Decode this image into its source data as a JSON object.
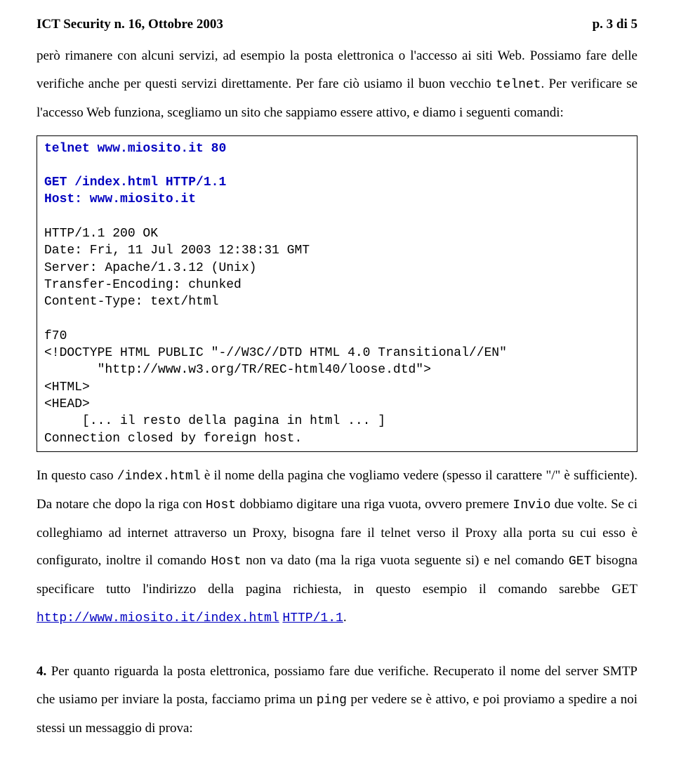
{
  "header": {
    "left": "ICT Security n. 16, Ottobre 2003",
    "right": "p. 3 di 5"
  },
  "p1": {
    "t1": "però rimanere con alcuni servizi, ad esempio la posta elettronica o l'accesso ai siti Web. Possiamo fare delle verifiche anche per questi servizi direttamente. Per fare ciò usiamo il buon vecchio ",
    "mono1": "telnet",
    "t2": ". Per verificare se l'accesso Web funziona, scegliamo un sito che sappiamo essere attivo, e diamo i seguenti comandi:"
  },
  "code": {
    "l1": "telnet www.miosito.it 80",
    "l2": "",
    "l3": "GET /index.html HTTP/1.1",
    "l4": "Host: www.miosito.it",
    "l5": "",
    "l6": "HTTP/1.1 200 OK",
    "l7": "Date: Fri, 11 Jul 2003 12:38:31 GMT",
    "l8": "Server: Apache/1.3.12 (Unix)",
    "l9": "Transfer-Encoding: chunked",
    "l10": "Content-Type: text/html",
    "l11": "",
    "l12": "f70",
    "l13": "<!DOCTYPE HTML PUBLIC \"-//W3C//DTD HTML 4.0 Transitional//EN\"",
    "l14": "       \"http://www.w3.org/TR/REC-html40/loose.dtd\">",
    "l15": "<HTML>",
    "l16": "<HEAD>",
    "l17": "     [... il resto della pagina in html ... ]",
    "l18": "Connection closed by foreign host."
  },
  "p2": {
    "t1": "In questo caso ",
    "mono1": "/index.html",
    "t2": " è il nome della pagina che vogliamo vedere (spesso il carattere \"/\" è sufficiente). Da notare che dopo la riga con ",
    "mono2": "Host",
    "t3": " dobbiamo digitare una riga vuota, ovvero premere ",
    "mono3": "Invio",
    "t4": " due volte. Se ci colleghiamo ad internet attraverso un Proxy, bisogna fare il telnet verso il Proxy alla porta su cui esso è configurato, inoltre il comando ",
    "mono4": "Host",
    "t5": " non va dato (ma la riga vuota seguente si) e nel comando ",
    "mono5": "GET",
    "t6": " bisogna specificare tutto l'indirizzo della pagina richiesta, in questo esempio il comando sarebbe GET ",
    "link1": "http://www.miosito.it/index.html",
    "space": " ",
    "link2": "HTTP/1.1",
    "t7": "."
  },
  "p3": {
    "num": "4.",
    "t1": " Per quanto riguarda la posta elettronica, possiamo fare due verifiche. Recuperato il nome del server SMTP che usiamo per inviare la posta, facciamo prima un ",
    "mono1": "ping",
    "t2": " per vedere se è attivo, e poi proviamo a spedire a noi stessi un messaggio di prova:"
  }
}
